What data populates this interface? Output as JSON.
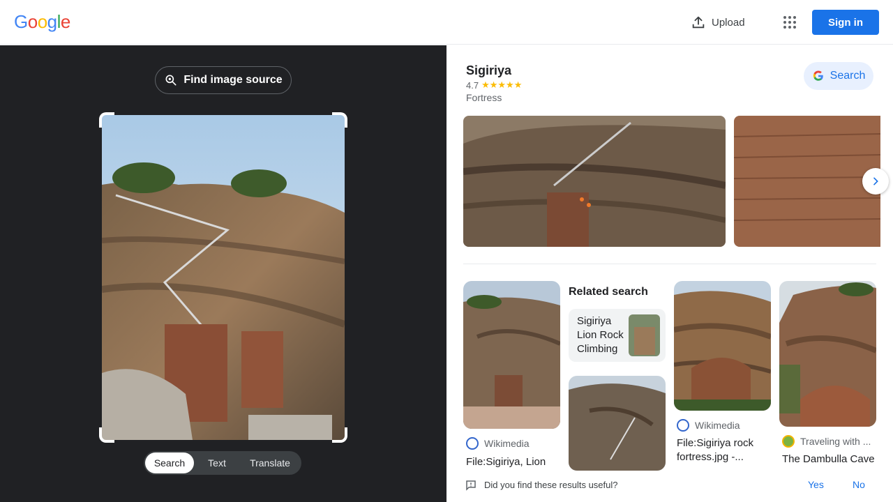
{
  "header": {
    "logo_letters": [
      "G",
      "o",
      "o",
      "g",
      "l",
      "e"
    ],
    "logo_colors": [
      "#4285f4",
      "#ea4335",
      "#fbbc05",
      "#4285f4",
      "#34a853",
      "#ea4335"
    ],
    "upload_label": "Upload",
    "apps_icon": "apps-grid-icon",
    "signin_label": "Sign in"
  },
  "lens": {
    "find_source_label": "Find image source",
    "modes": [
      {
        "label": "Search",
        "active": true
      },
      {
        "label": "Text",
        "active": false
      },
      {
        "label": "Translate",
        "active": false
      }
    ]
  },
  "knowledge_panel": {
    "title": "Sigiriya",
    "rating": "4.7",
    "stars": "★★★★★",
    "type": "Fortress",
    "search_label": "Search"
  },
  "results": {
    "related_heading": "Related search",
    "related_card": "Sigiriya Lion Rock Climbing",
    "items": [
      {
        "source": "Wikimedia",
        "title": "File:Sigiriya, Lion"
      },
      {
        "source": "Wikimedia",
        "title": "File:Sigiriya rock fortress.jpg -..."
      },
      {
        "source": "Traveling with ...",
        "title": "The Dambulla Cave"
      }
    ]
  },
  "feedback": {
    "question": "Did you find these results useful?",
    "yes": "Yes",
    "no": "No"
  },
  "colors": {
    "accent": "#1a73e8",
    "dark_bg": "#202124",
    "star": "#fbbc04"
  }
}
